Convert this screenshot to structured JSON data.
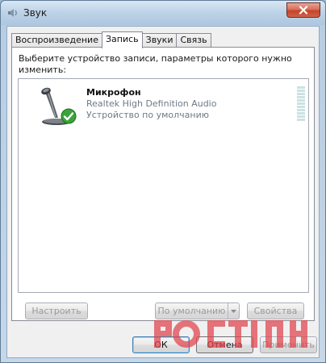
{
  "window": {
    "title": "Звук",
    "close_icon": "close-icon"
  },
  "tabs": [
    {
      "label": "Воспроизведение",
      "active": false
    },
    {
      "label": "Запись",
      "active": true
    },
    {
      "label": "Звуки",
      "active": false
    },
    {
      "label": "Связь",
      "active": false
    }
  ],
  "panel": {
    "instruction": "Выберите устройство записи, параметры которого нужно изменить:"
  },
  "devices": [
    {
      "name": "Микрофон",
      "driver": "Realtek High Definition Audio",
      "status": "Устройство по умолчанию",
      "icon": "microphone-icon",
      "badge": "default-check-icon",
      "level": 0
    }
  ],
  "buttons": {
    "configure": "Настроить",
    "set_default": "По умолчанию",
    "properties": "Свойства",
    "ok": "ОК",
    "cancel": "Отмена",
    "apply": "Применить"
  },
  "colors": {
    "titlebar": "#bcd2e7",
    "close_button": "#c4432b",
    "check_badge": "#3aa33a",
    "level_meter": "#cbe3e2",
    "watermark": "#e0434b"
  }
}
